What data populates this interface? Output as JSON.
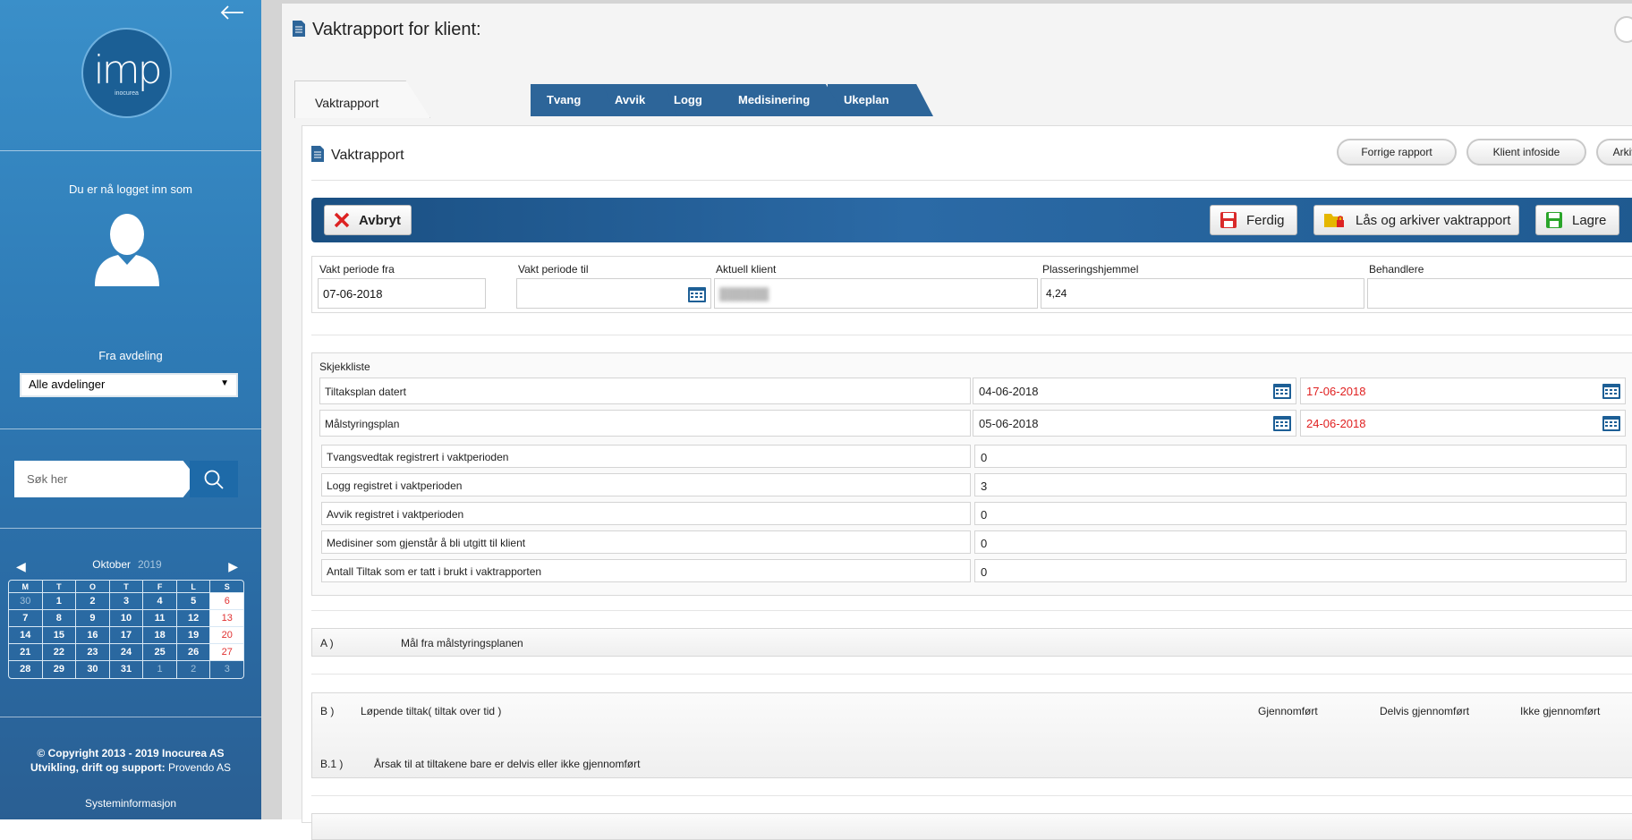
{
  "sidebar": {
    "logo_text": "imp",
    "logo_sub": "inocurea",
    "logged_in_label": "Du er nå logget inn som",
    "from_department_label": "Fra avdeling",
    "department_selected": "Alle avdelinger",
    "search_placeholder": "Søk her",
    "calendar": {
      "month": "Oktober",
      "year": "2019",
      "weekdays": [
        "M",
        "T",
        "O",
        "T",
        "F",
        "L",
        "S"
      ],
      "weeks": [
        [
          "30",
          "1",
          "2",
          "3",
          "4",
          "5",
          "6"
        ],
        [
          "7",
          "8",
          "9",
          "10",
          "11",
          "12",
          "13"
        ],
        [
          "14",
          "15",
          "16",
          "17",
          "18",
          "19",
          "20"
        ],
        [
          "21",
          "22",
          "23",
          "24",
          "25",
          "26",
          "27"
        ],
        [
          "28",
          "29",
          "30",
          "31",
          "1",
          "2",
          "3"
        ]
      ]
    },
    "copyright": "© Copyright 2013 - 2019 Inocurea AS",
    "support_label": "Utvikling, drift og support:",
    "support_company": "Provendo AS",
    "system_info": "Systeminformasjon"
  },
  "page": {
    "title": "Vaktrapport for klient:"
  },
  "tabs": [
    "Vaktrapport",
    "Tvang",
    "Avvik",
    "Logg",
    "Medisinering",
    "Ukeplan"
  ],
  "card": {
    "title": "Vaktrapport",
    "buttons": {
      "previous": "Forrige rapport",
      "client_info": "Klient infoside",
      "archive": "Arkiv"
    }
  },
  "actions": {
    "cancel": "Avbryt",
    "done": "Ferdig",
    "lock_archive": "Lås og arkiver vaktrapport",
    "save": "Lagre"
  },
  "fields": {
    "period_from_label": "Vakt periode fra",
    "period_from_value": "07-06-2018",
    "period_to_label": "Vakt periode til",
    "period_to_value": "",
    "current_client_label": "Aktuell klient",
    "placement_label": "Plasseringshjemmel",
    "placement_value": "4,24",
    "practitioners_label": "Behandlere",
    "practitioners_value": ""
  },
  "checklist": {
    "title": "Skjekkliste",
    "rows": [
      {
        "label": "Tiltaksplan datert",
        "date1": "04-06-2018",
        "date2": "17-06-2018"
      },
      {
        "label": "Målstyringsplan",
        "date1": "05-06-2018",
        "date2": "24-06-2018"
      }
    ],
    "counts": [
      {
        "label": "Tvangsvedtak registrert i vaktperioden",
        "value": "0"
      },
      {
        "label": "Logg registret i vaktperioden",
        "value": "3"
      },
      {
        "label": "Avvik registret i vaktperioden",
        "value": "0"
      },
      {
        "label": "Medisiner som gjenstår å bli utgitt til klient",
        "value": "0"
      },
      {
        "label": "Antall Tiltak som er tatt i brukt i vaktrapporten",
        "value": "0"
      }
    ]
  },
  "sections": {
    "a_key": "A )",
    "a_title": "Mål fra målstyringsplanen",
    "b_key": "B )",
    "b_title": "Løpende tiltak( tiltak over tid )",
    "b_col1": "Gjennomført",
    "b_col2": "Delvis gjennomført",
    "b_col3": "Ikke gjennomført",
    "b1_key": "B.1 )",
    "b1_title": "Årsak til at tiltakene bare er delvis eller ikke gjennomført"
  },
  "colors": {
    "sidebar_blue": "#2f7cb7",
    "tab_blue": "#2d6599",
    "calendar_icon_blue": "#1d5f96",
    "red_date": "#e02020"
  }
}
